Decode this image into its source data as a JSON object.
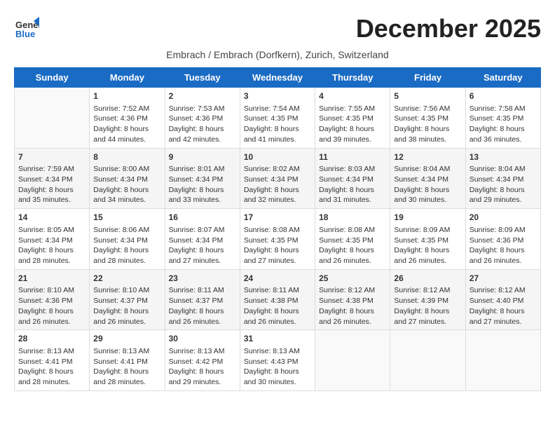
{
  "header": {
    "logo_general": "General",
    "logo_blue": "Blue",
    "month_title": "December 2025",
    "subtitle": "Embrach / Embrach (Dorfkern), Zurich, Switzerland"
  },
  "calendar": {
    "days_of_week": [
      "Sunday",
      "Monday",
      "Tuesday",
      "Wednesday",
      "Thursday",
      "Friday",
      "Saturday"
    ],
    "weeks": [
      [
        {
          "day": "",
          "sunrise": "",
          "sunset": "",
          "daylight": ""
        },
        {
          "day": "1",
          "sunrise": "Sunrise: 7:52 AM",
          "sunset": "Sunset: 4:36 PM",
          "daylight": "Daylight: 8 hours and 44 minutes."
        },
        {
          "day": "2",
          "sunrise": "Sunrise: 7:53 AM",
          "sunset": "Sunset: 4:36 PM",
          "daylight": "Daylight: 8 hours and 42 minutes."
        },
        {
          "day": "3",
          "sunrise": "Sunrise: 7:54 AM",
          "sunset": "Sunset: 4:35 PM",
          "daylight": "Daylight: 8 hours and 41 minutes."
        },
        {
          "day": "4",
          "sunrise": "Sunrise: 7:55 AM",
          "sunset": "Sunset: 4:35 PM",
          "daylight": "Daylight: 8 hours and 39 minutes."
        },
        {
          "day": "5",
          "sunrise": "Sunrise: 7:56 AM",
          "sunset": "Sunset: 4:35 PM",
          "daylight": "Daylight: 8 hours and 38 minutes."
        },
        {
          "day": "6",
          "sunrise": "Sunrise: 7:58 AM",
          "sunset": "Sunset: 4:35 PM",
          "daylight": "Daylight: 8 hours and 36 minutes."
        }
      ],
      [
        {
          "day": "7",
          "sunrise": "Sunrise: 7:59 AM",
          "sunset": "Sunset: 4:34 PM",
          "daylight": "Daylight: 8 hours and 35 minutes."
        },
        {
          "day": "8",
          "sunrise": "Sunrise: 8:00 AM",
          "sunset": "Sunset: 4:34 PM",
          "daylight": "Daylight: 8 hours and 34 minutes."
        },
        {
          "day": "9",
          "sunrise": "Sunrise: 8:01 AM",
          "sunset": "Sunset: 4:34 PM",
          "daylight": "Daylight: 8 hours and 33 minutes."
        },
        {
          "day": "10",
          "sunrise": "Sunrise: 8:02 AM",
          "sunset": "Sunset: 4:34 PM",
          "daylight": "Daylight: 8 hours and 32 minutes."
        },
        {
          "day": "11",
          "sunrise": "Sunrise: 8:03 AM",
          "sunset": "Sunset: 4:34 PM",
          "daylight": "Daylight: 8 hours and 31 minutes."
        },
        {
          "day": "12",
          "sunrise": "Sunrise: 8:04 AM",
          "sunset": "Sunset: 4:34 PM",
          "daylight": "Daylight: 8 hours and 30 minutes."
        },
        {
          "day": "13",
          "sunrise": "Sunrise: 8:04 AM",
          "sunset": "Sunset: 4:34 PM",
          "daylight": "Daylight: 8 hours and 29 minutes."
        }
      ],
      [
        {
          "day": "14",
          "sunrise": "Sunrise: 8:05 AM",
          "sunset": "Sunset: 4:34 PM",
          "daylight": "Daylight: 8 hours and 28 minutes."
        },
        {
          "day": "15",
          "sunrise": "Sunrise: 8:06 AM",
          "sunset": "Sunset: 4:34 PM",
          "daylight": "Daylight: 8 hours and 28 minutes."
        },
        {
          "day": "16",
          "sunrise": "Sunrise: 8:07 AM",
          "sunset": "Sunset: 4:34 PM",
          "daylight": "Daylight: 8 hours and 27 minutes."
        },
        {
          "day": "17",
          "sunrise": "Sunrise: 8:08 AM",
          "sunset": "Sunset: 4:35 PM",
          "daylight": "Daylight: 8 hours and 27 minutes."
        },
        {
          "day": "18",
          "sunrise": "Sunrise: 8:08 AM",
          "sunset": "Sunset: 4:35 PM",
          "daylight": "Daylight: 8 hours and 26 minutes."
        },
        {
          "day": "19",
          "sunrise": "Sunrise: 8:09 AM",
          "sunset": "Sunset: 4:35 PM",
          "daylight": "Daylight: 8 hours and 26 minutes."
        },
        {
          "day": "20",
          "sunrise": "Sunrise: 8:09 AM",
          "sunset": "Sunset: 4:36 PM",
          "daylight": "Daylight: 8 hours and 26 minutes."
        }
      ],
      [
        {
          "day": "21",
          "sunrise": "Sunrise: 8:10 AM",
          "sunset": "Sunset: 4:36 PM",
          "daylight": "Daylight: 8 hours and 26 minutes."
        },
        {
          "day": "22",
          "sunrise": "Sunrise: 8:10 AM",
          "sunset": "Sunset: 4:37 PM",
          "daylight": "Daylight: 8 hours and 26 minutes."
        },
        {
          "day": "23",
          "sunrise": "Sunrise: 8:11 AM",
          "sunset": "Sunset: 4:37 PM",
          "daylight": "Daylight: 8 hours and 26 minutes."
        },
        {
          "day": "24",
          "sunrise": "Sunrise: 8:11 AM",
          "sunset": "Sunset: 4:38 PM",
          "daylight": "Daylight: 8 hours and 26 minutes."
        },
        {
          "day": "25",
          "sunrise": "Sunrise: 8:12 AM",
          "sunset": "Sunset: 4:38 PM",
          "daylight": "Daylight: 8 hours and 26 minutes."
        },
        {
          "day": "26",
          "sunrise": "Sunrise: 8:12 AM",
          "sunset": "Sunset: 4:39 PM",
          "daylight": "Daylight: 8 hours and 27 minutes."
        },
        {
          "day": "27",
          "sunrise": "Sunrise: 8:12 AM",
          "sunset": "Sunset: 4:40 PM",
          "daylight": "Daylight: 8 hours and 27 minutes."
        }
      ],
      [
        {
          "day": "28",
          "sunrise": "Sunrise: 8:13 AM",
          "sunset": "Sunset: 4:41 PM",
          "daylight": "Daylight: 8 hours and 28 minutes."
        },
        {
          "day": "29",
          "sunrise": "Sunrise: 8:13 AM",
          "sunset": "Sunset: 4:41 PM",
          "daylight": "Daylight: 8 hours and 28 minutes."
        },
        {
          "day": "30",
          "sunrise": "Sunrise: 8:13 AM",
          "sunset": "Sunset: 4:42 PM",
          "daylight": "Daylight: 8 hours and 29 minutes."
        },
        {
          "day": "31",
          "sunrise": "Sunrise: 8:13 AM",
          "sunset": "Sunset: 4:43 PM",
          "daylight": "Daylight: 8 hours and 30 minutes."
        },
        {
          "day": "",
          "sunrise": "",
          "sunset": "",
          "daylight": ""
        },
        {
          "day": "",
          "sunrise": "",
          "sunset": "",
          "daylight": ""
        },
        {
          "day": "",
          "sunrise": "",
          "sunset": "",
          "daylight": ""
        }
      ]
    ]
  }
}
